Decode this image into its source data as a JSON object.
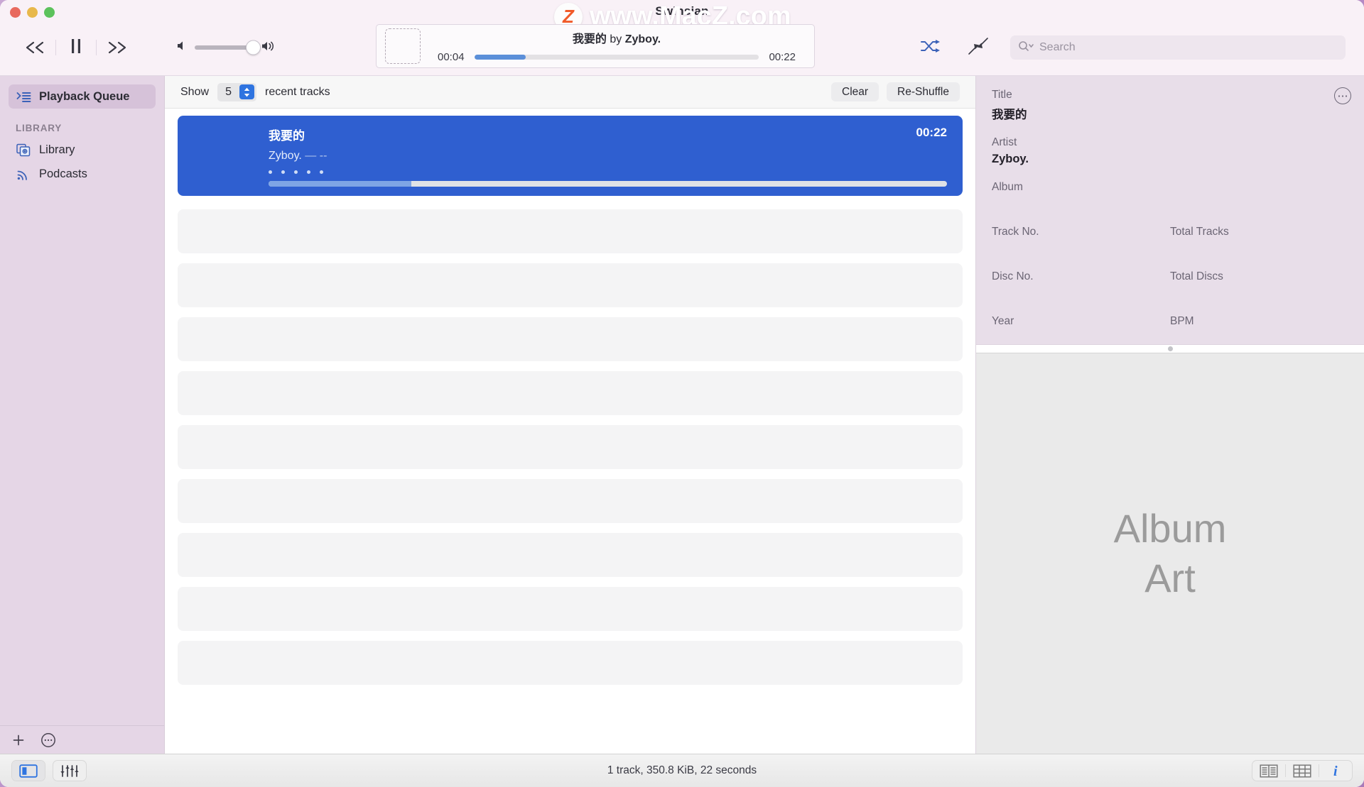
{
  "window": {
    "title": "Swinsian",
    "watermark": "www.MacZ.com",
    "watermark_badge": "Z"
  },
  "toolbar": {
    "previous_label": "Previous Track",
    "playpause_label": "Pause",
    "next_label": "Next Track",
    "volume_level": 100,
    "shuffle_label": "Shuffle",
    "shuffle_active_color": "#2f5fd0",
    "miniplayer_label": "Mini Player",
    "search_placeholder": "Search",
    "search_value": ""
  },
  "now_playing": {
    "title": "我要的",
    "connector": "by",
    "artist": "Zyboy.",
    "elapsed": "00:04",
    "remaining": "00:22",
    "progress_percent": 18,
    "artwork_placeholder": ""
  },
  "sidebar": {
    "items": [
      {
        "label": "Playback Queue",
        "icon": "queue-icon",
        "selected": true
      }
    ],
    "section_header": "LIBRARY",
    "library_items": [
      {
        "label": "Library",
        "icon": "library-icon"
      },
      {
        "label": "Podcasts",
        "icon": "podcast-icon"
      }
    ],
    "add_label": "+",
    "more_label": "⋯"
  },
  "queue_toolbar": {
    "show_label": "Show",
    "count": "5",
    "recent_label": "recent tracks",
    "clear_label": "Clear",
    "reshuffle_label": "Re-Shuffle"
  },
  "queue": {
    "active_track": {
      "title": "我要的",
      "artist": "Zyboy.",
      "separator": "—",
      "album": "--",
      "duration": "00:22",
      "rating_dots": 5,
      "progress_percent": 21
    },
    "placeholder_rows": 9
  },
  "inspector": {
    "more_label": "⋯",
    "fields": [
      {
        "label": "Title",
        "value": "我要的"
      },
      {
        "label": "Artist",
        "value": "Zyboy."
      },
      {
        "label": "Album",
        "value": ""
      }
    ],
    "grid_fields": [
      {
        "label": "Track No.",
        "value": ""
      },
      {
        "label": "Total Tracks",
        "value": ""
      },
      {
        "label": "Disc No.",
        "value": ""
      },
      {
        "label": "Total Discs",
        "value": ""
      },
      {
        "label": "Year",
        "value": ""
      },
      {
        "label": "BPM",
        "value": ""
      }
    ],
    "art_placeholder_line1": "Album",
    "art_placeholder_line2": "Art"
  },
  "statusbar": {
    "sidebar_toggle_label": "Toggle Sidebar",
    "equalizer_label": "Equalizer",
    "status_text": "1 track,  350.8 KiB,  22 seconds",
    "list_view_label": "List View",
    "grid_view_label": "Grid View",
    "info_label": "Info",
    "accent_color": "#2f74e0"
  }
}
